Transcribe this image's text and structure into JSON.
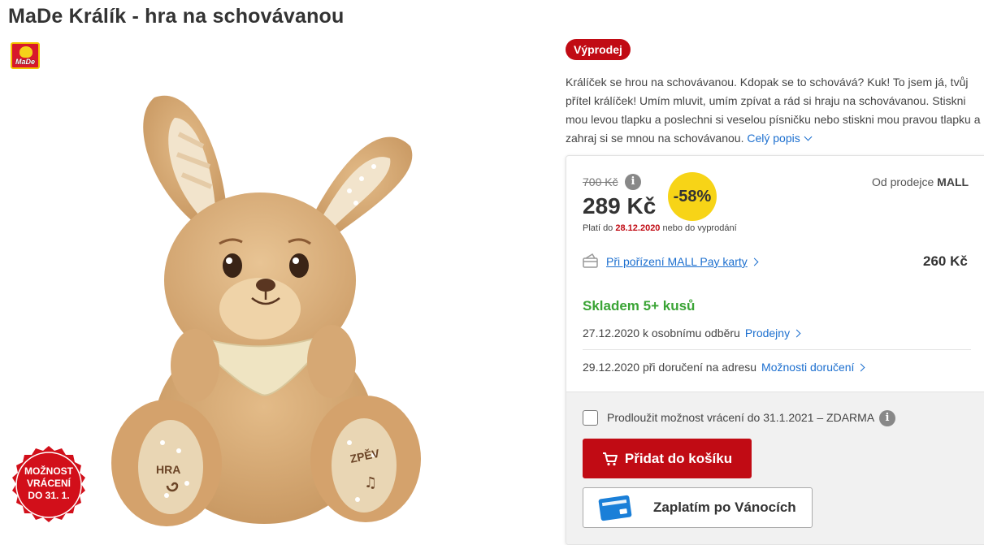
{
  "product": {
    "title": "MaDe Králík - hra na schovávanou",
    "brand_logo_text": "MaDe",
    "return_badge": [
      "MOŽNOST",
      "VRÁCENÍ",
      "DO 31. 1."
    ],
    "toy_labels": {
      "left_paw": "HRA",
      "right_paw": "ZPĚV"
    }
  },
  "sale_badge": "Výprodej",
  "description": {
    "text": "Králíček se hrou na schovávanou. Kdopak se to schovává? Kuk! To jsem já, tvůj přítel králíček! Umím mluvit, umím zpívat a rád si hraju na schovávanou. Stiskni mou levou tlapku a poslechni si veselou písničku nebo stiskni mou pravou tlapku a zahraj si se mnou na schovávanou.",
    "more_link": "Celý popis"
  },
  "pricing": {
    "old_price": "700 Kč",
    "price": "289 Kč",
    "discount": "-58%",
    "valid_prefix": "Platí do",
    "valid_date": "28.12.2020",
    "valid_suffix": "nebo do vyprodání",
    "seller_prefix": "Od prodejce",
    "seller_name": "MALL",
    "mallpay_link": "Při pořízení MALL Pay karty",
    "mallpay_price": "260 Kč"
  },
  "availability": {
    "stock": "Skladem 5+ kusů",
    "pickup_text": "27.12.2020 k osobnímu odběru",
    "pickup_link": "Prodejny",
    "delivery_text": "29.12.2020 při doručení na adresu",
    "delivery_link": "Možnosti doručení"
  },
  "actions": {
    "extend_return_label": "Prodloužit možnost vrácení do 31.1.2021 – ZDARMA",
    "extend_return_checked": false,
    "add_to_cart": "Přidat do košíku",
    "pay_after_xmas": "Zaplatím po Vánocích"
  },
  "colors": {
    "brand_red": "#c10b14",
    "link_blue": "#1c6fcf",
    "stock_green": "#3aa435",
    "discount_yellow": "#f7d417"
  }
}
